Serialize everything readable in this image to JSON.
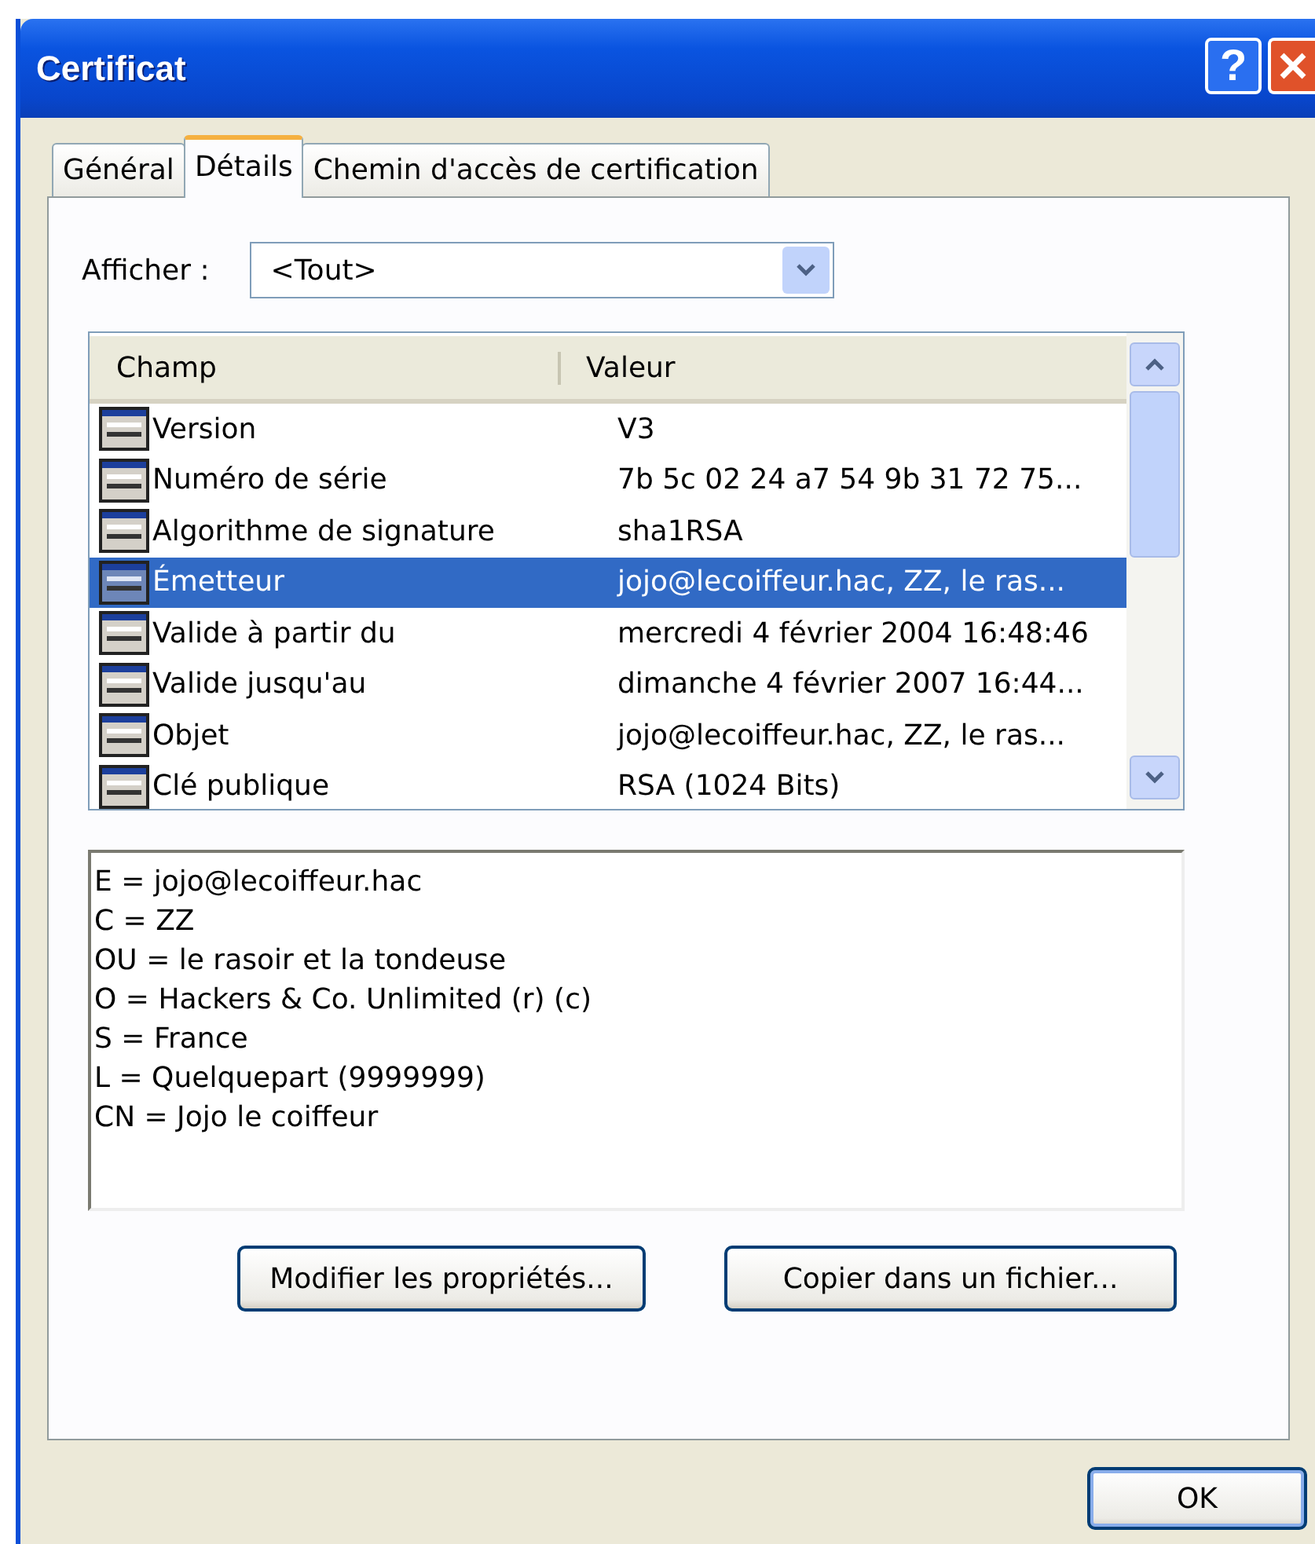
{
  "window": {
    "title": "Certificat",
    "help_glyph": "?"
  },
  "tabs": [
    {
      "label": "Général",
      "selected": false
    },
    {
      "label": "Détails",
      "selected": true
    },
    {
      "label": "Chemin d'accès de certification",
      "selected": false
    }
  ],
  "show": {
    "label": "Afficher :",
    "value": "<Tout>"
  },
  "fields": {
    "columns": [
      "Champ",
      "Valeur"
    ],
    "rows": [
      {
        "field": "Version",
        "value": "V3",
        "selected": false
      },
      {
        "field": "Numéro de série",
        "value": "7b 5c 02 24 a7 54 9b 31 72 75...",
        "selected": false
      },
      {
        "field": "Algorithme de signature",
        "value": "sha1RSA",
        "selected": false
      },
      {
        "field": "Émetteur",
        "value": "jojo@lecoiffeur.hac, ZZ, le ras...",
        "selected": true
      },
      {
        "field": "Valide à partir du",
        "value": "mercredi 4 février 2004 16:48:46",
        "selected": false
      },
      {
        "field": "Valide jusqu'au",
        "value": "dimanche 4 février 2007 16:44...",
        "selected": false
      },
      {
        "field": "Objet",
        "value": "jojo@lecoiffeur.hac, ZZ, le ras...",
        "selected": false
      },
      {
        "field": "Clé publique",
        "value": "RSA (1024 Bits)",
        "selected": false
      }
    ]
  },
  "details": [
    "E = jojo@lecoiffeur.hac",
    "C = ZZ",
    "OU = le rasoir et la tondeuse",
    "O = Hackers & Co. Unlimited (r) (c)",
    "S = France",
    "L = Quelquepart (9999999)",
    "CN = Jojo le coiffeur"
  ],
  "buttons": [
    "Modifier les propriétés...",
    "Copier dans un fichier..."
  ],
  "ok": "OK"
}
